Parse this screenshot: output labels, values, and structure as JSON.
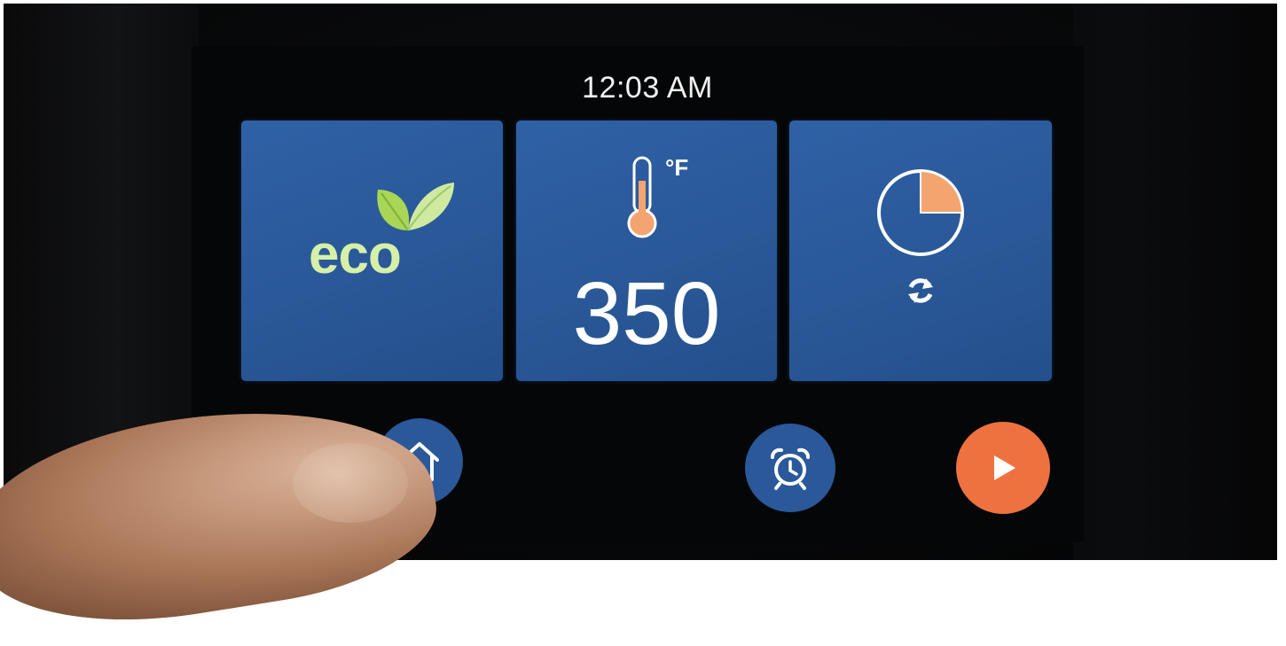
{
  "status_bar": {
    "time": "12:03 AM"
  },
  "tiles": {
    "eco": {
      "label": "eco",
      "icon": "leaf-icon"
    },
    "temperature": {
      "value": "350",
      "unit": "°F",
      "icon": "thermometer-icon"
    },
    "timer": {
      "icon": "timer-dial-icon",
      "secondary_icon": "refresh-icon",
      "elapsed_fraction": 0.25
    }
  },
  "bottom_controls": {
    "light_icon": "light-icon",
    "home_icon": "home-icon",
    "alarm_icon": "alarm-clock-icon",
    "start_icon": "play-icon"
  },
  "colors": {
    "tile_blue": "#2a5898",
    "start_orange": "#ee7240",
    "eco_green": "#d6f0a8",
    "accent_orange": "#f4a46e"
  }
}
